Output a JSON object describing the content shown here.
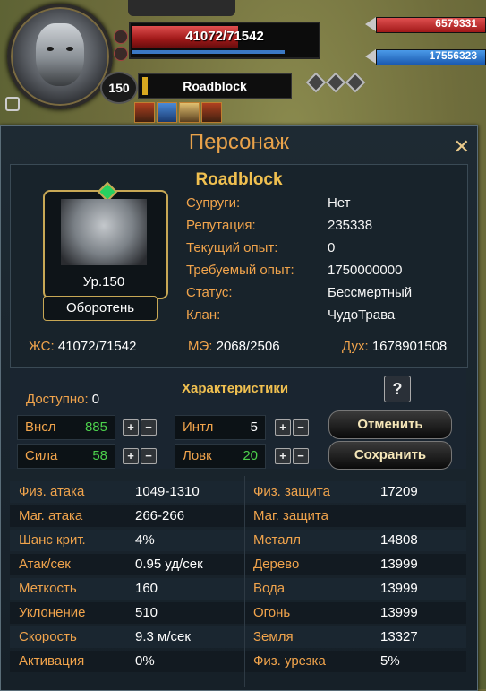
{
  "hud": {
    "hp_text": "41072/71542",
    "hp_fraction": 0.574,
    "level": "150",
    "player_name": "Roadblock",
    "target_hp_value": "6579331",
    "target_mp_value": "17556323",
    "colors": {
      "hp": "#c42020",
      "mp": "#2f7ad8",
      "accent": "#e8a24a"
    }
  },
  "panel": {
    "title": "Персонаж",
    "close_icon": "close-x-icon",
    "char_name": "Roadblock",
    "portrait_level": "Ур.150",
    "class_button": "Оборотень",
    "info": [
      {
        "label": "Супруги:",
        "value": "Нет"
      },
      {
        "label": "Репутация:",
        "value": "235338"
      },
      {
        "label": "Текущий опыт:",
        "value": "0"
      },
      {
        "label": "Требуемый опыт:",
        "value": "1750000000"
      },
      {
        "label": "Статус:",
        "value": "Бессмертный"
      },
      {
        "label": "Клан:",
        "value": "ЧудоТрава"
      }
    ],
    "hp_label": "ЖС:",
    "hp_value": "41072/71542",
    "mp_label": "МЭ:",
    "mp_value": "2068/2506",
    "spirit_label": "Дух:",
    "spirit_value": "1678901508"
  },
  "characteristics": {
    "title": "Характеристики",
    "available_label": "Доступно:",
    "available_value": "0",
    "help_label": "?",
    "attrs": [
      {
        "label": "Внсл",
        "value": "885",
        "green": true
      },
      {
        "label": "Интл",
        "value": "5",
        "green": false
      },
      {
        "label": "Сила",
        "value": "58",
        "green": true
      },
      {
        "label": "Ловк",
        "value": "20",
        "green": true
      }
    ],
    "plus": "+",
    "minus": "−",
    "cancel_button": "Отменить",
    "save_button": "Сохранить"
  },
  "stats": [
    {
      "l1": "Физ. атака",
      "v1": "1049-1310",
      "l2": "Физ. защита",
      "v2": "17209"
    },
    {
      "l1": "Маг. атака",
      "v1": "266-266",
      "l2": "Маг. защита",
      "v2": ""
    },
    {
      "l1": "Шанс крит.",
      "v1": "4%",
      "l2": "Металл",
      "v2": "14808"
    },
    {
      "l1": "Атак/сек",
      "v1": "0.95 уд/сек",
      "l2": "Дерево",
      "v2": "13999"
    },
    {
      "l1": "Меткость",
      "v1": "160",
      "l2": "Вода",
      "v2": "13999"
    },
    {
      "l1": "Уклонение",
      "v1": "510",
      "l2": "Огонь",
      "v2": "13999"
    },
    {
      "l1": "Скорость",
      "v1": "9.3 м/сек",
      "l2": "Земля",
      "v2": "13327"
    },
    {
      "l1": "Активация",
      "v1": "0%",
      "l2": "Физ. урезка",
      "v2": "5%"
    }
  ]
}
